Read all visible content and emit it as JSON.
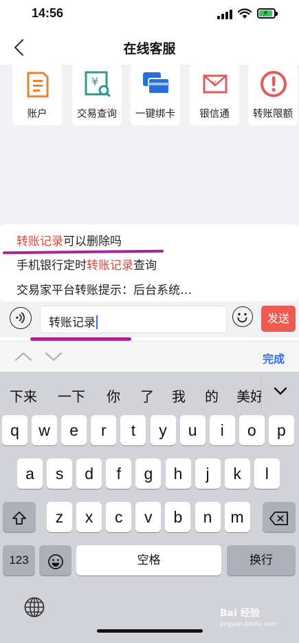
{
  "status_bar": {
    "time": "14:56"
  },
  "nav": {
    "title": "在线客服"
  },
  "services": [
    {
      "label": "账户",
      "icon": "account-document-icon",
      "color": "#ef7f2e"
    },
    {
      "label": "交易查询",
      "icon": "transaction-search-icon",
      "color": "#2e9a86"
    },
    {
      "label": "一键绑卡",
      "icon": "bind-card-icon",
      "color": "#2a6fd6"
    },
    {
      "label": "银信通",
      "icon": "envelope-yen-icon",
      "color": "#e25a5a"
    },
    {
      "label": "转账限额",
      "icon": "alert-circle-icon",
      "color": "#e25a5a"
    }
  ],
  "suggestions": [
    {
      "highlight": "转账记录",
      "rest": "可以删除吗"
    },
    {
      "before": "手机银行定时",
      "highlight": "转账记录",
      "after": "查询"
    },
    {
      "text": "交易家平台转账提示：后台系统…"
    }
  ],
  "input": {
    "value": "转账记录",
    "send_label": "发送"
  },
  "accessory": {
    "done_label": "完成"
  },
  "keyboard": {
    "candidates": [
      "下来",
      "一下",
      "你",
      "了",
      "我",
      "的",
      "美好"
    ],
    "row1": [
      "q",
      "w",
      "e",
      "r",
      "t",
      "y",
      "u",
      "i",
      "o",
      "p"
    ],
    "row2": [
      "a",
      "s",
      "d",
      "f",
      "g",
      "h",
      "j",
      "k",
      "l"
    ],
    "row3": [
      "z",
      "x",
      "c",
      "v",
      "b",
      "n",
      "m"
    ],
    "numbers_label": "123",
    "space_label": "空格",
    "return_label": "换行"
  },
  "watermark": {
    "line1": "Bai 经验",
    "line2": "jingyan.baidu.com"
  },
  "colors": {
    "accent": "#2b6ef7",
    "highlight": "#e0473e",
    "send": "#ec5a50",
    "annotation": "#a3279c"
  }
}
